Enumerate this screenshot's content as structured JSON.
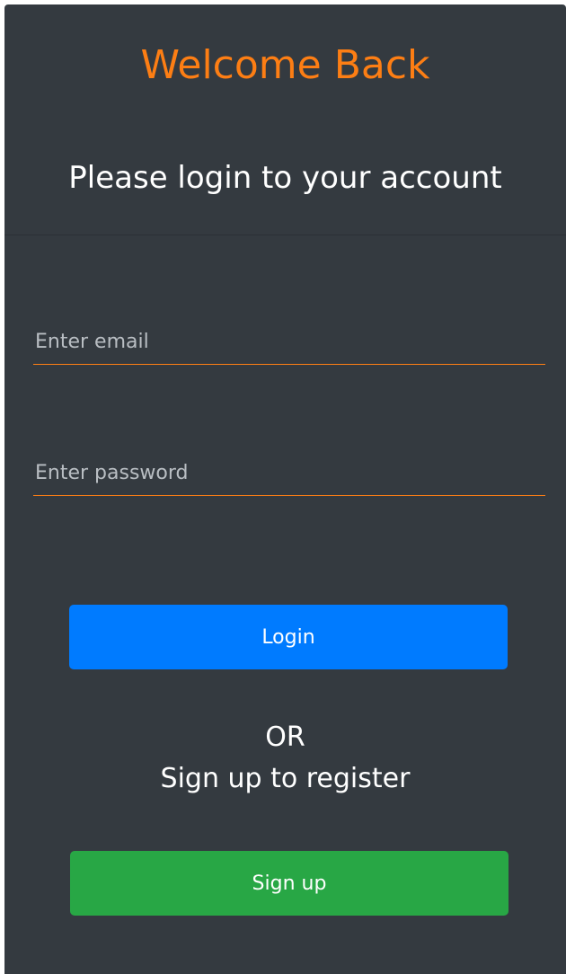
{
  "header": {
    "title": "Welcome Back",
    "subtitle": "Please login to your account"
  },
  "form": {
    "email_placeholder": "Enter email",
    "email_value": "",
    "password_placeholder": "Enter password",
    "password_value": "",
    "login_label": "Login"
  },
  "alternate": {
    "or_text": "OR",
    "register_text": "Sign up to register",
    "signup_label": "Sign up"
  },
  "colors": {
    "card_background": "#343a40",
    "accent_orange": "#fd7e14",
    "login_blue": "#007bff",
    "signup_green": "#28a745",
    "text_white": "#ffffff"
  }
}
